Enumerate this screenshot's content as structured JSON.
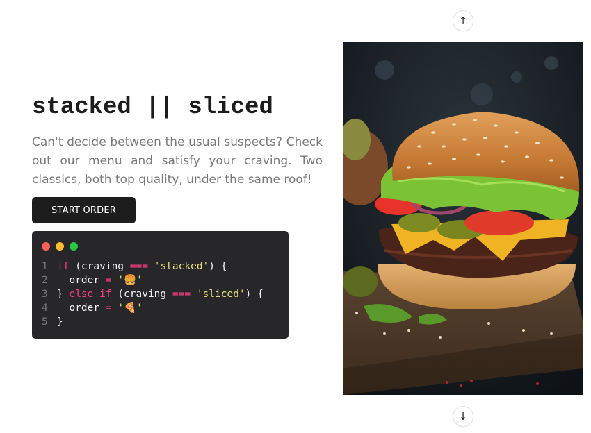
{
  "hero": {
    "title": "stacked || sliced",
    "description": "Can't decide between the usual suspects? Check out our menu and satisfy your craving. Two classics, both top quality, under the same roof!",
    "cta_label": "START ORDER"
  },
  "code_snippet": {
    "window_dot_colors": [
      "#ff5f56",
      "#ffbd2e",
      "#27c93f"
    ],
    "lines": [
      {
        "number": "1",
        "tokens": [
          {
            "text": "if ",
            "type": "kw"
          },
          {
            "text": "(craving ",
            "type": "plain"
          },
          {
            "text": "===",
            "type": "op"
          },
          {
            "text": " ",
            "type": "plain"
          },
          {
            "text": "'stacked'",
            "type": "str"
          },
          {
            "text": ") {",
            "type": "plain"
          }
        ]
      },
      {
        "number": "2",
        "tokens": [
          {
            "text": "  order ",
            "type": "plain"
          },
          {
            "text": "=",
            "type": "op"
          },
          {
            "text": " ",
            "type": "plain"
          },
          {
            "text": "'🍔'",
            "type": "str"
          }
        ]
      },
      {
        "number": "3",
        "tokens": [
          {
            "text": "} ",
            "type": "plain"
          },
          {
            "text": "else if",
            "type": "kw"
          },
          {
            "text": " (craving ",
            "type": "plain"
          },
          {
            "text": "===",
            "type": "op"
          },
          {
            "text": " ",
            "type": "plain"
          },
          {
            "text": "'sliced'",
            "type": "str"
          },
          {
            "text": ") {",
            "type": "plain"
          }
        ]
      },
      {
        "number": "4",
        "tokens": [
          {
            "text": "  order ",
            "type": "plain"
          },
          {
            "text": "=",
            "type": "op"
          },
          {
            "text": " ",
            "type": "plain"
          },
          {
            "text": "'🍕'",
            "type": "str"
          }
        ]
      },
      {
        "number": "5",
        "tokens": [
          {
            "text": "}",
            "type": "plain"
          }
        ]
      }
    ]
  },
  "carousel": {
    "up_icon": "arrow-up-icon",
    "down_icon": "arrow-down-icon",
    "image_subject": "burger-photo"
  },
  "colors": {
    "button_bg": "#1d1d1d",
    "code_bg": "#27272a",
    "keyword": "#ff3d7f",
    "string": "#e8e07d"
  }
}
